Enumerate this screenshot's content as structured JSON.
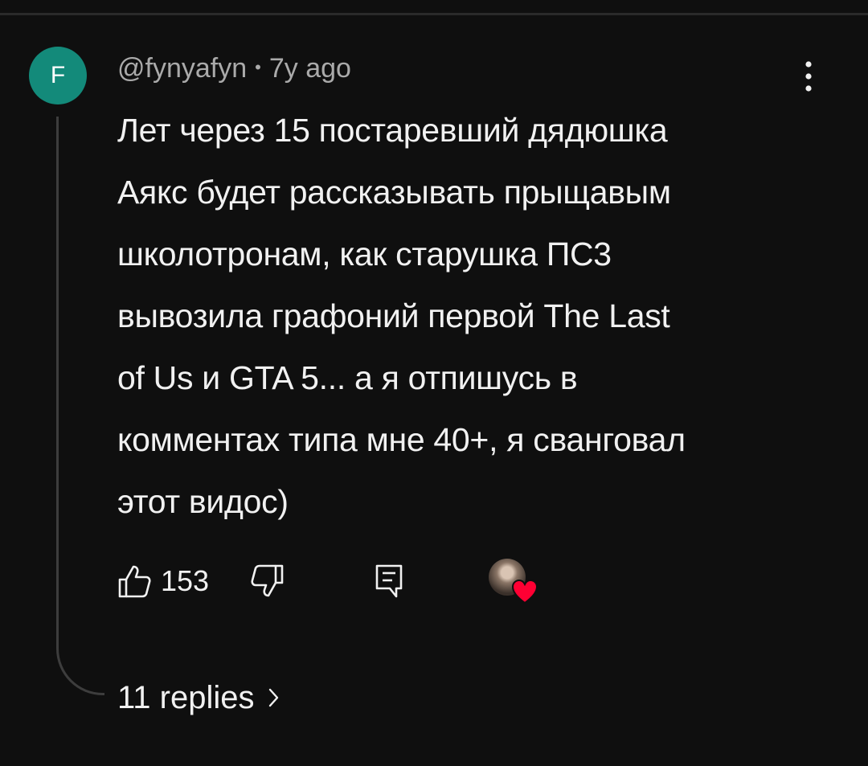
{
  "comment": {
    "avatar_letter": "F",
    "author": "@fynyafyn",
    "separator": "•",
    "time": "7y ago",
    "text": "Лет через 15 постаревший дядюшка\nАякс будет рассказывать прыщавым\nшколотронам, как старушка ПС3\nвывозила графоний первой The Last\nof Us и GTA 5... а я отпишусь в\nкомментах типа мне 40+, я сванговал\nэтот видос)",
    "like_count": "153",
    "replies_label": "11 replies"
  },
  "icons": {
    "more": "more-vert-icon",
    "like": "thumb-up-icon",
    "dislike": "thumb-down-icon",
    "reply": "comment-reply-icon",
    "heart": "heart-icon",
    "chevron": "chevron-right-icon"
  },
  "colors": {
    "background": "#0f0f0f",
    "avatar": "#138a7a",
    "heart": "#ff0033",
    "meta_text": "#aaaaaa",
    "text": "#f1f1f1"
  }
}
